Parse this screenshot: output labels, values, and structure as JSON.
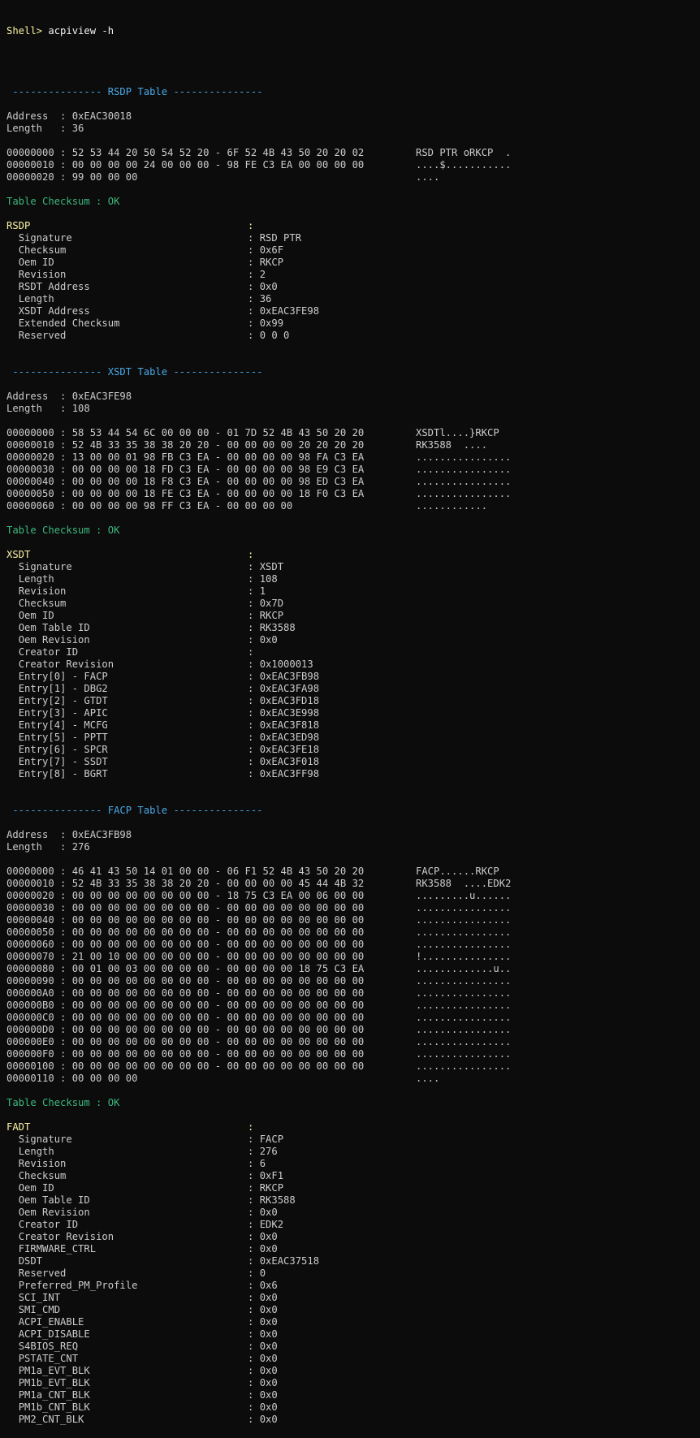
{
  "colors": {
    "background": "#0c0c0c",
    "text": "#cccccc",
    "prompt": "#f9f1a5",
    "banner": "#4aa8e6",
    "checksum_ok": "#3db87e",
    "table_name": "#f9f1a5"
  },
  "prompt": {
    "label": "Shell> ",
    "command": "acpiview -h"
  },
  "sections": [
    {
      "banner": " --------------- RSDP Table ---------------",
      "address_line": "Address  : 0xEAC30018",
      "length_line": "Length   : 36",
      "hex_rows": [
        {
          "hex": "00000000 : 52 53 44 20 50 54 52 20 - 6F 52 4B 43 50 20 20 02",
          "ascii": "RSD PTR oRKCP  ."
        },
        {
          "hex": "00000010 : 00 00 00 00 24 00 00 00 - 98 FE C3 EA 00 00 00 00",
          "ascii": "....$..........."
        },
        {
          "hex": "00000020 : 99 00 00 00",
          "ascii": "...."
        }
      ],
      "checksum": "Table Checksum : OK",
      "name": "RSDP",
      "fields": [
        {
          "label": "Signature",
          "value": "RSD PTR"
        },
        {
          "label": "Checksum",
          "value": "0x6F"
        },
        {
          "label": "Oem ID",
          "value": "RKCP"
        },
        {
          "label": "Revision",
          "value": "2"
        },
        {
          "label": "RSDT Address",
          "value": "0x0"
        },
        {
          "label": "Length",
          "value": "36"
        },
        {
          "label": "XSDT Address",
          "value": "0xEAC3FE98"
        },
        {
          "label": "Extended Checksum",
          "value": "0x99"
        },
        {
          "label": "Reserved",
          "value": "0 0 0"
        }
      ]
    },
    {
      "banner": " --------------- XSDT Table ---------------",
      "address_line": "Address  : 0xEAC3FE98",
      "length_line": "Length   : 108",
      "hex_rows": [
        {
          "hex": "00000000 : 58 53 44 54 6C 00 00 00 - 01 7D 52 4B 43 50 20 20",
          "ascii": "XSDTl....}RKCP"
        },
        {
          "hex": "00000010 : 52 4B 33 35 38 38 20 20 - 00 00 00 00 20 20 20 20",
          "ascii": "RK3588  ...."
        },
        {
          "hex": "00000020 : 13 00 00 01 98 FB C3 EA - 00 00 00 00 98 FA C3 EA",
          "ascii": "................"
        },
        {
          "hex": "00000030 : 00 00 00 00 18 FD C3 EA - 00 00 00 00 98 E9 C3 EA",
          "ascii": "................"
        },
        {
          "hex": "00000040 : 00 00 00 00 18 F8 C3 EA - 00 00 00 00 98 ED C3 EA",
          "ascii": "................"
        },
        {
          "hex": "00000050 : 00 00 00 00 18 FE C3 EA - 00 00 00 00 18 F0 C3 EA",
          "ascii": "................"
        },
        {
          "hex": "00000060 : 00 00 00 00 98 FF C3 EA - 00 00 00 00",
          "ascii": "............"
        }
      ],
      "checksum": "Table Checksum : OK",
      "name": "XSDT",
      "fields": [
        {
          "label": "Signature",
          "value": "XSDT"
        },
        {
          "label": "Length",
          "value": "108"
        },
        {
          "label": "Revision",
          "value": "1"
        },
        {
          "label": "Checksum",
          "value": "0x7D"
        },
        {
          "label": "Oem ID",
          "value": "RKCP"
        },
        {
          "label": "Oem Table ID",
          "value": "RK3588"
        },
        {
          "label": "Oem Revision",
          "value": "0x0"
        },
        {
          "label": "Creator ID",
          "value": ""
        },
        {
          "label": "Creator Revision",
          "value": "0x1000013"
        },
        {
          "label": "Entry[0] - FACP",
          "value": "0xEAC3FB98"
        },
        {
          "label": "Entry[1] - DBG2",
          "value": "0xEAC3FA98"
        },
        {
          "label": "Entry[2] - GTDT",
          "value": "0xEAC3FD18"
        },
        {
          "label": "Entry[3] - APIC",
          "value": "0xEAC3E998"
        },
        {
          "label": "Entry[4] - MCFG",
          "value": "0xEAC3F818"
        },
        {
          "label": "Entry[5] - PPTT",
          "value": "0xEAC3ED98"
        },
        {
          "label": "Entry[6] - SPCR",
          "value": "0xEAC3FE18"
        },
        {
          "label": "Entry[7] - SSDT",
          "value": "0xEAC3F018"
        },
        {
          "label": "Entry[8] - BGRT",
          "value": "0xEAC3FF98"
        }
      ]
    },
    {
      "banner": " --------------- FACP Table ---------------",
      "address_line": "Address  : 0xEAC3FB98",
      "length_line": "Length   : 276",
      "hex_rows": [
        {
          "hex": "00000000 : 46 41 43 50 14 01 00 00 - 06 F1 52 4B 43 50 20 20",
          "ascii": "FACP......RKCP"
        },
        {
          "hex": "00000010 : 52 4B 33 35 38 38 20 20 - 00 00 00 00 45 44 4B 32",
          "ascii": "RK3588  ....EDK2"
        },
        {
          "hex": "00000020 : 00 00 00 00 00 00 00 00 - 18 75 C3 EA 00 06 00 00",
          "ascii": ".........u......"
        },
        {
          "hex": "00000030 : 00 00 00 00 00 00 00 00 - 00 00 00 00 00 00 00 00",
          "ascii": "................"
        },
        {
          "hex": "00000040 : 00 00 00 00 00 00 00 00 - 00 00 00 00 00 00 00 00",
          "ascii": "................"
        },
        {
          "hex": "00000050 : 00 00 00 00 00 00 00 00 - 00 00 00 00 00 00 00 00",
          "ascii": "................"
        },
        {
          "hex": "00000060 : 00 00 00 00 00 00 00 00 - 00 00 00 00 00 00 00 00",
          "ascii": "................"
        },
        {
          "hex": "00000070 : 21 00 10 00 00 00 00 00 - 00 00 00 00 00 00 00 00",
          "ascii": "!..............."
        },
        {
          "hex": "00000080 : 00 01 00 03 00 00 00 00 - 00 00 00 00 18 75 C3 EA",
          "ascii": ".............u.."
        },
        {
          "hex": "00000090 : 00 00 00 00 00 00 00 00 - 00 00 00 00 00 00 00 00",
          "ascii": "................"
        },
        {
          "hex": "000000A0 : 00 00 00 00 00 00 00 00 - 00 00 00 00 00 00 00 00",
          "ascii": "................"
        },
        {
          "hex": "000000B0 : 00 00 00 00 00 00 00 00 - 00 00 00 00 00 00 00 00",
          "ascii": "................"
        },
        {
          "hex": "000000C0 : 00 00 00 00 00 00 00 00 - 00 00 00 00 00 00 00 00",
          "ascii": "................"
        },
        {
          "hex": "000000D0 : 00 00 00 00 00 00 00 00 - 00 00 00 00 00 00 00 00",
          "ascii": "................"
        },
        {
          "hex": "000000E0 : 00 00 00 00 00 00 00 00 - 00 00 00 00 00 00 00 00",
          "ascii": "................"
        },
        {
          "hex": "000000F0 : 00 00 00 00 00 00 00 00 - 00 00 00 00 00 00 00 00",
          "ascii": "................"
        },
        {
          "hex": "00000100 : 00 00 00 00 00 00 00 00 - 00 00 00 00 00 00 00 00",
          "ascii": "................"
        },
        {
          "hex": "00000110 : 00 00 00 00",
          "ascii": "...."
        }
      ],
      "checksum": "Table Checksum : OK",
      "name": "FADT",
      "fields": [
        {
          "label": "Signature",
          "value": "FACP"
        },
        {
          "label": "Length",
          "value": "276"
        },
        {
          "label": "Revision",
          "value": "6"
        },
        {
          "label": "Checksum",
          "value": "0xF1"
        },
        {
          "label": "Oem ID",
          "value": "RKCP"
        },
        {
          "label": "Oem Table ID",
          "value": "RK3588"
        },
        {
          "label": "Oem Revision",
          "value": "0x0"
        },
        {
          "label": "Creator ID",
          "value": "EDK2"
        },
        {
          "label": "Creator Revision",
          "value": "0x0"
        },
        {
          "label": "FIRMWARE_CTRL",
          "value": "0x0"
        },
        {
          "label": "DSDT",
          "value": "0xEAC37518"
        },
        {
          "label": "Reserved",
          "value": "0"
        },
        {
          "label": "Preferred_PM_Profile",
          "value": "0x6"
        },
        {
          "label": "SCI_INT",
          "value": "0x0"
        },
        {
          "label": "SMI_CMD",
          "value": "0x0"
        },
        {
          "label": "ACPI_ENABLE",
          "value": "0x0"
        },
        {
          "label": "ACPI_DISABLE",
          "value": "0x0"
        },
        {
          "label": "S4BIOS_REQ",
          "value": "0x0"
        },
        {
          "label": "PSTATE_CNT",
          "value": "0x0"
        },
        {
          "label": "PM1a_EVT_BLK",
          "value": "0x0"
        },
        {
          "label": "PM1b_EVT_BLK",
          "value": "0x0"
        },
        {
          "label": "PM1a_CNT_BLK",
          "value": "0x0"
        },
        {
          "label": "PM1b_CNT_BLK",
          "value": "0x0"
        },
        {
          "label": "PM2_CNT_BLK",
          "value": "0x0"
        }
      ]
    }
  ]
}
